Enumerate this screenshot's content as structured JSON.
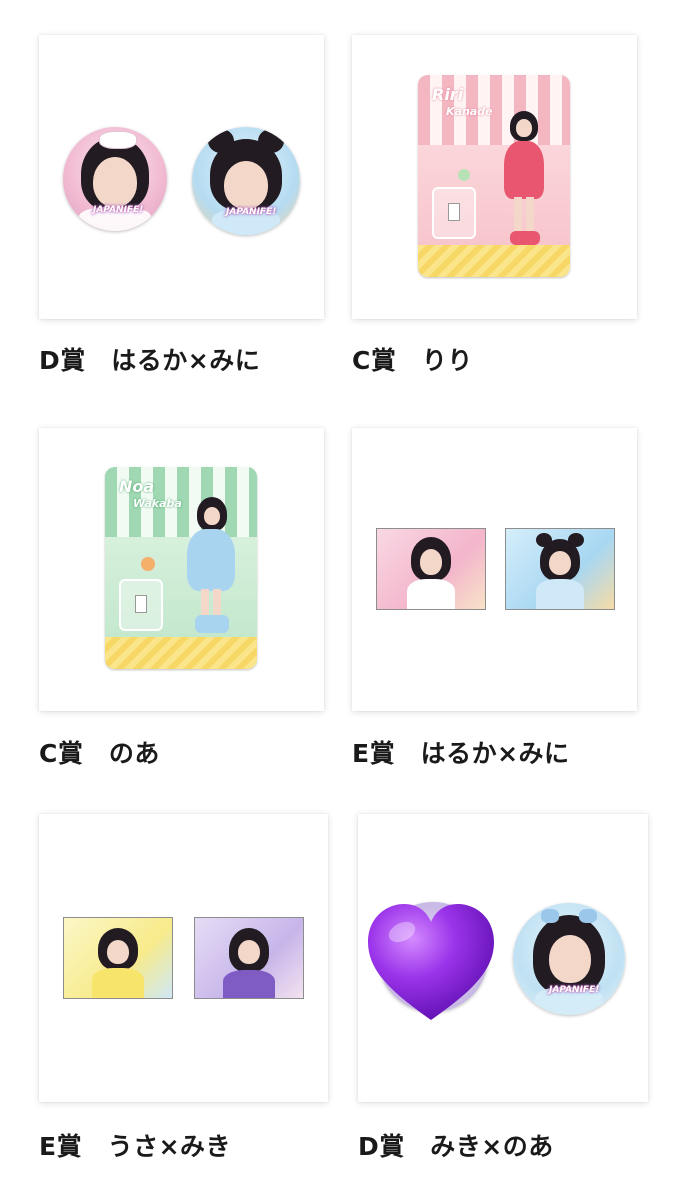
{
  "items": [
    {
      "label": "D賞　はるか×みに",
      "badge_text": "JAPANIFE!"
    },
    {
      "label": "C賞　りり",
      "stand_name": "Riri",
      "stand_surname": "Kanade"
    },
    {
      "label": "C賞　のあ",
      "stand_name": "Noa",
      "stand_surname": "Wakaba"
    },
    {
      "label": "E賞　はるか×みに"
    },
    {
      "label": "E賞　うさ×みき"
    },
    {
      "label": "D賞　みき×のあ",
      "badge_text": "JAPANIFE!"
    }
  ],
  "colors": {
    "label_text": "#1a1a1a",
    "card_bg": "#ffffff",
    "pink_stand": "#f4b7c2",
    "green_stand": "#9fd8b2",
    "heart": "#8b2be2"
  }
}
